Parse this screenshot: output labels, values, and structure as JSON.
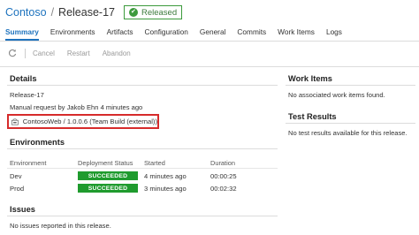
{
  "header": {
    "project": "Contoso",
    "separator": "/",
    "release": "Release-17",
    "status": "Released"
  },
  "tabs": [
    {
      "label": "Summary",
      "active": true
    },
    {
      "label": "Environments"
    },
    {
      "label": "Artifacts"
    },
    {
      "label": "Configuration"
    },
    {
      "label": "General"
    },
    {
      "label": "Commits"
    },
    {
      "label": "Work Items"
    },
    {
      "label": "Logs"
    }
  ],
  "toolbar": {
    "refresh_icon": "refresh-icon",
    "cancel": "Cancel",
    "restart": "Restart",
    "abandon": "Abandon"
  },
  "details": {
    "heading": "Details",
    "release_name": "Release-17",
    "requested": "Manual request by Jakob Ehn 4 minutes ago",
    "artifact": "ContosoWeb / 1.0.0.6 (Team Build (external))",
    "artifact_icon": "build-icon"
  },
  "environments": {
    "heading": "Environments",
    "columns": [
      "Environment",
      "Deployment Status",
      "Started",
      "Duration"
    ],
    "rows": [
      {
        "name": "Dev",
        "status": "SUCCEEDED",
        "started": "4 minutes ago",
        "duration": "00:00:25"
      },
      {
        "name": "Prod",
        "status": "SUCCEEDED",
        "started": "3 minutes ago",
        "duration": "00:02:32"
      }
    ]
  },
  "issues": {
    "heading": "Issues",
    "message": "No issues reported in this release."
  },
  "work_items": {
    "heading": "Work Items",
    "message": "No associated work items found."
  },
  "test_results": {
    "heading": "Test Results",
    "message": "No test results available for this release."
  },
  "colors": {
    "link": "#1e73be",
    "success": "#1f9b2e",
    "highlight_border": "#d62b2b"
  }
}
